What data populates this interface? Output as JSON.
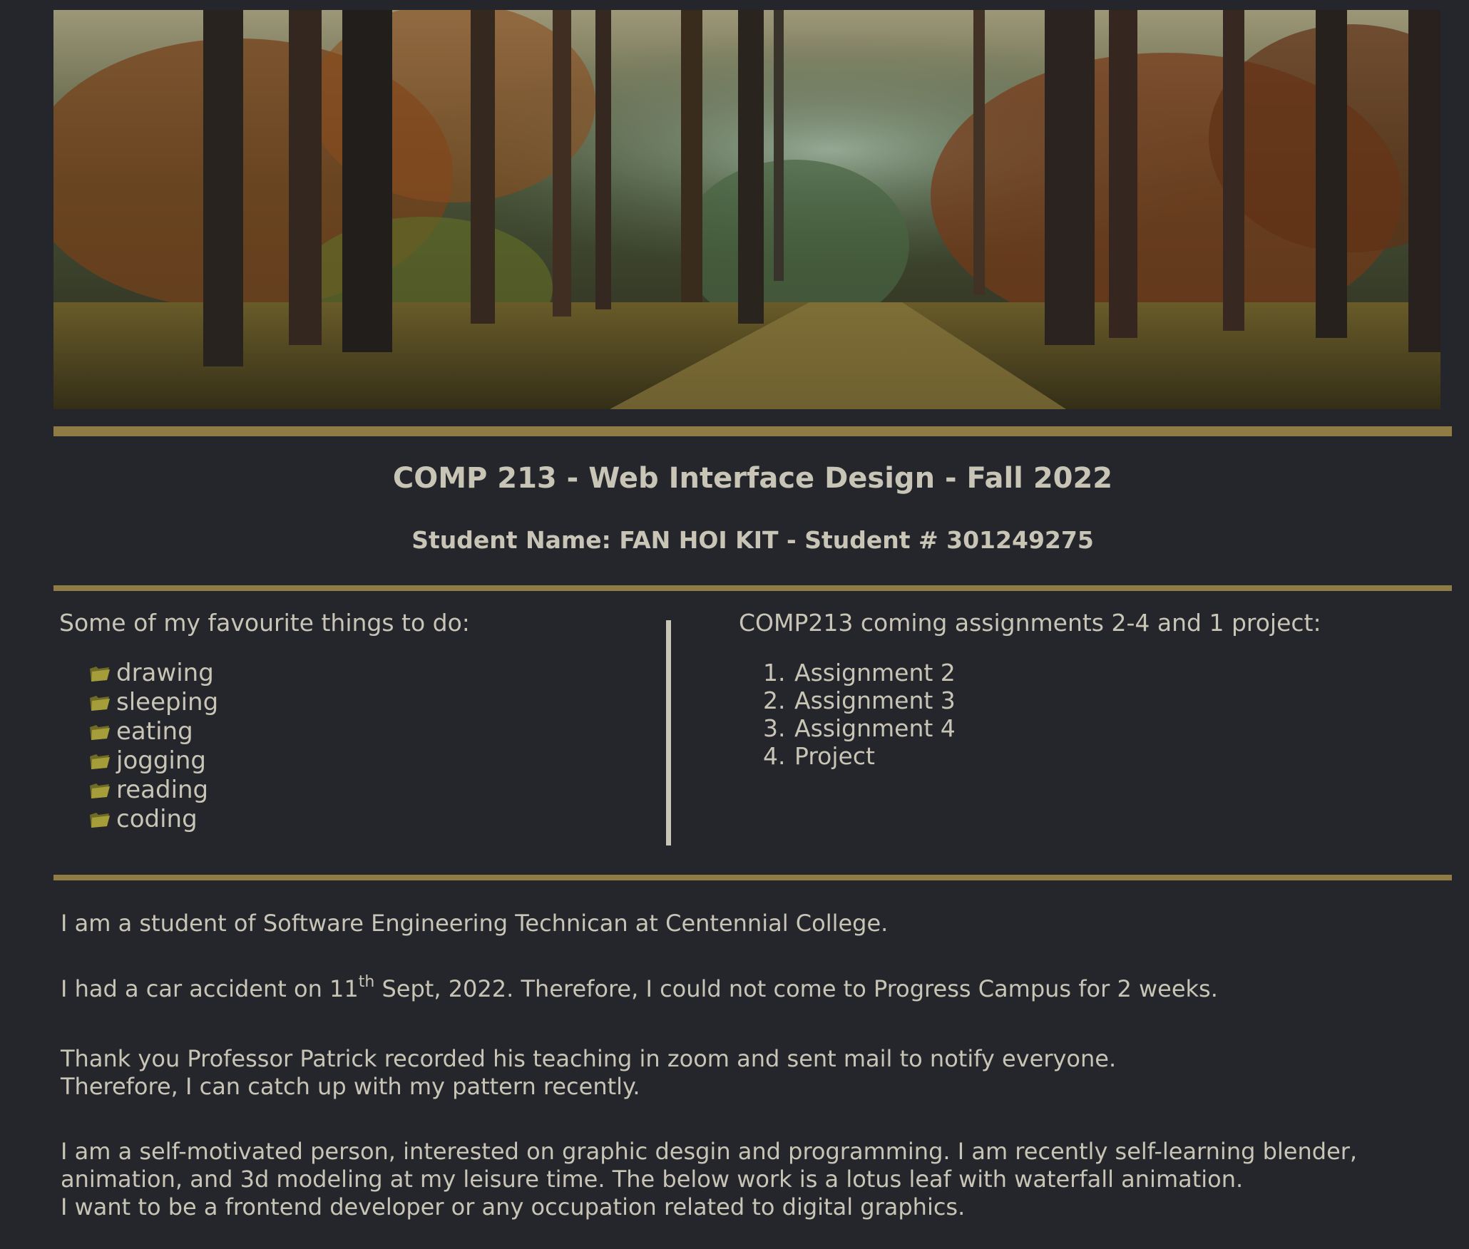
{
  "banner": {
    "image": "autumn-forest-path-image"
  },
  "header": {
    "course_title": "COMP 213 - Web Interface Design - Fall 2022",
    "student_line": "Student Name: FAN HOI KIT - Student # 301249275"
  },
  "favourites": {
    "heading": "Some of my favourite things to do:",
    "icon": "folder-icon",
    "items": [
      "drawing",
      "sleeping",
      "eating",
      "jogging",
      "reading",
      "coding"
    ]
  },
  "assignments": {
    "heading": "COMP213 coming assignments 2-4 and 1 project:",
    "items": [
      {
        "num": "1.",
        "label": "Assignment 2"
      },
      {
        "num": "2.",
        "label": "Assignment 3"
      },
      {
        "num": "3.",
        "label": "Assignment 4"
      },
      {
        "num": "4.",
        "label": "Project"
      }
    ]
  },
  "about": {
    "p1": "I am a student of Software Engineering Technican at Centennial College.",
    "p2_before": "I had a car accident on 11",
    "p2_sup": "th",
    "p2_after": " Sept, 2022. Therefore, I could not come to Progress Campus for 2 weeks.",
    "p3_line1": "Thank you Professor Patrick recorded his teaching in zoom and sent mail to notify everyone.",
    "p3_line2": "Therefore, I can catch up with my pattern recently.",
    "p4_line1": "I am a self-motivated person, interested on graphic desgin and programming. I am recently self-learning blender,",
    "p4_line2": "animation, and 3d modeling at my leisure time. The below work is a lotus leaf with waterfall animation.",
    "p4_line3": "I want to be a frontend developer or any occupation related to digital graphics."
  },
  "colors": {
    "background": "#25262b",
    "text": "#c8c5b6",
    "accent_rule": "#8f7b44"
  }
}
